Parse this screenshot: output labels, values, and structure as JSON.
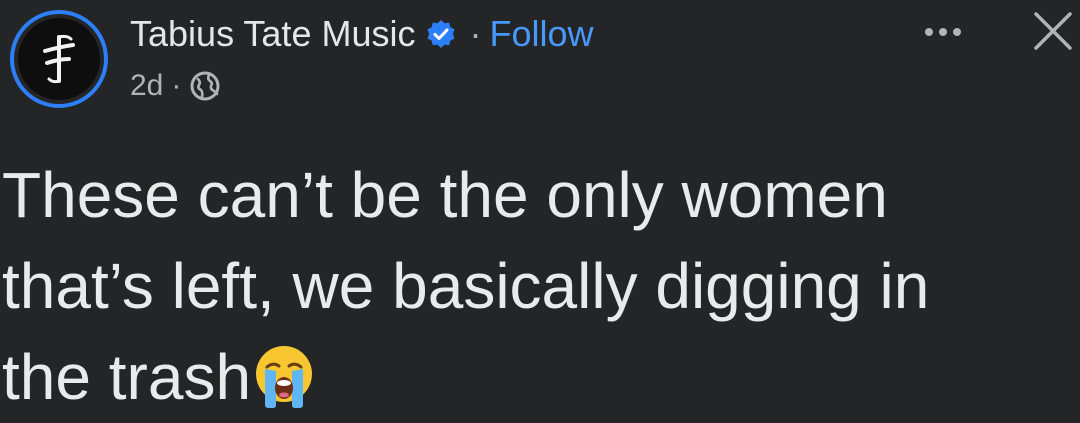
{
  "post": {
    "author": {
      "name": "Tabius Tate Music",
      "verified": true,
      "follow_label": "Follow",
      "separator": "·"
    },
    "meta": {
      "time": "2d",
      "separator": "·",
      "audience_icon": "globe-icon"
    },
    "actions": {
      "more_icon": "more-options-icon",
      "more_label": "···",
      "close_icon": "close-icon"
    },
    "text_lines": [
      "These can’t be the only women",
      "that’s left, we basically digging in",
      "the trash"
    ],
    "emoji": "loudly-crying-face"
  },
  "colors": {
    "background": "#242526",
    "text": "#e4e6eb",
    "secondary_text": "#b0b3b8",
    "link": "#4599ff",
    "verified_badge": "#2d7ff9",
    "avatar_ring": "#2d7ff9"
  }
}
